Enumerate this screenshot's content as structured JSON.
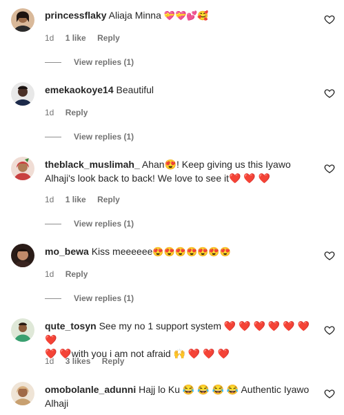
{
  "comments": [
    {
      "username": "princessflaky",
      "text": " Aliaja Minna ",
      "emoji": "💝💝💕🥰",
      "time": "1d",
      "likes": "1 like",
      "reply_label": "Reply",
      "view_replies": "View replies (1)",
      "avatar_color": "#b07a4e"
    },
    {
      "username": "emekaokoye14",
      "text": " Beautiful",
      "emoji": "",
      "time": "1d",
      "likes": "",
      "reply_label": "Reply",
      "view_replies": "View replies (1)",
      "avatar_color": "#3a2a22"
    },
    {
      "username": "theblack_muslimah_",
      "text_line1": " Ahan😍! Keep giving us this Iyawo",
      "text_line2": "Alhaji's look back to back! We love to see it❤️ ❤️ ❤️",
      "time": "1d",
      "likes": "1 like",
      "reply_label": "Reply",
      "view_replies": "View replies (1)",
      "avatar_color": "#c94040"
    },
    {
      "username": "mo_bewa",
      "text": " Kiss meeeeee",
      "emoji": "😍😍😍😍😍😍😍",
      "time": "1d",
      "likes": "",
      "reply_label": "Reply",
      "view_replies": "View replies (1)",
      "avatar_color": "#5a3a30"
    },
    {
      "username": "qute_tosyn",
      "text_line1": " See my no 1 support system ❤️ ❤️ ❤️ ❤️ ❤️ ❤️ ❤️",
      "text_line2": "❤️ ❤️with you i am not afraid 🙌 ❤️ ❤️ ❤️",
      "time": "1d",
      "likes": "3 likes",
      "reply_label": "Reply",
      "avatar_color": "#3aa070"
    },
    {
      "username": "omobolanle_adunni",
      "text_line1": " Hajj lo Ku 😂 😂 😂 😂 Authentic Iyawo",
      "text_line2": "Alhaji",
      "avatar_color": "#c8a070"
    }
  ],
  "colors": {
    "text": "#262626",
    "meta": "#737373",
    "heart_outline": "#262626"
  },
  "icons": {
    "like": "heart-outline-icon"
  }
}
